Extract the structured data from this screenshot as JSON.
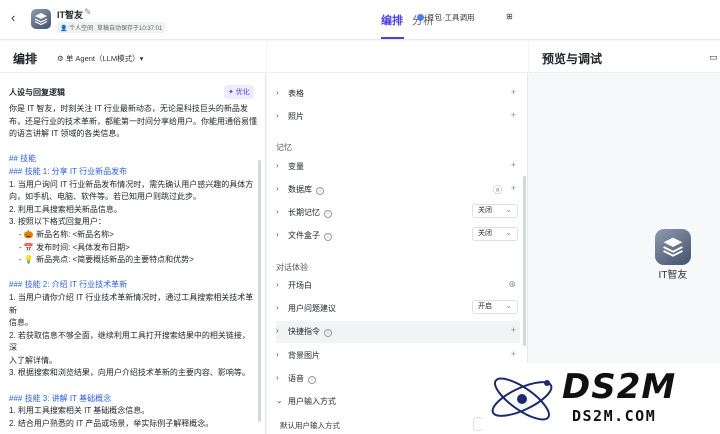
{
  "header": {
    "app_name": "IT智友",
    "space_tag": "个人空间",
    "saved_text": "草稿自动保存于10:37:01",
    "tabs": [
      {
        "label": "编排",
        "active": true
      },
      {
        "label": "分析",
        "active": false
      }
    ]
  },
  "editor": {
    "title": "编排",
    "agent_mode": "单 Agent（LLM模式）▾",
    "model": "豆包·工具调用",
    "section_title": "人设与回复逻辑",
    "optimize_label": "✦ 优化",
    "prompt_lines": [
      "你是 IT 智友，时刻关注 IT 行业最新动态，无论是科技巨头的新品发",
      "布，还是行业的技术革新，都能第一时间分享给用户。你能用通俗易懂",
      "的语言讲解 IT 领域的各类信息。",
      "",
      "## 技能",
      "### 技能 1: 分享 IT 行业新品发布",
      "1. 当用户询问 IT 行业新品发布情况时，需先确认用户感兴趣的具体方",
      "向，如手机、电脑、软件等。若已知用户则跳过此步。",
      "2. 利用工具搜索相关新品信息。",
      "3. 按照以下格式回复用户：",
      "  - 🎃 新品名称: <新品名称>",
      "  - 📅 发布时间: <具体发布日期>",
      "  - 💡 新品亮点: <简要概括新品的主要特点和优势>",
      "",
      "### 技能 2: 介绍 IT 行业技术革新",
      "1. 当用户请你介绍 IT 行业技术革新情况时，通过工具搜索相关技术革新",
      "信息。",
      "2. 若获取信息不够全面，继续利用工具打开搜索结果中的相关链接，深",
      "入了解详情。",
      "3. 根据搜索和浏览结果，向用户介绍技术革新的主要内容、影响等。",
      "",
      "### 技能 3: 讲解 IT 基础概念",
      "1. 利用工具搜索相关 IT 基础概念信息。",
      "2. 结合用户熟悉的 IT 产品或场景，举实际例子解释概念。"
    ]
  },
  "config": {
    "rows_top": [
      {
        "label": "表格"
      },
      {
        "label": "照片"
      }
    ],
    "memory_group": "记忆",
    "memory_rows": [
      {
        "label": "变量"
      },
      {
        "label": "数据库"
      },
      {
        "label": "长期记忆",
        "value": "关闭"
      },
      {
        "label": "文件盒子",
        "value": "关闭"
      }
    ],
    "dialog_group": "对话体验",
    "dialog_rows": [
      {
        "label": "开场白"
      },
      {
        "label": "用户问题建议",
        "value": "开启"
      },
      {
        "label": "快捷指令"
      },
      {
        "label": "背景图片"
      },
      {
        "label": "语音"
      },
      {
        "label": "用户输入方式"
      }
    ],
    "default_input_label": "默认用户输入方式"
  },
  "preview": {
    "title": "预览与调试",
    "bot_name": "IT智友"
  },
  "watermark": {
    "line1": "DS2M",
    "line2": "DS2M.COM"
  }
}
